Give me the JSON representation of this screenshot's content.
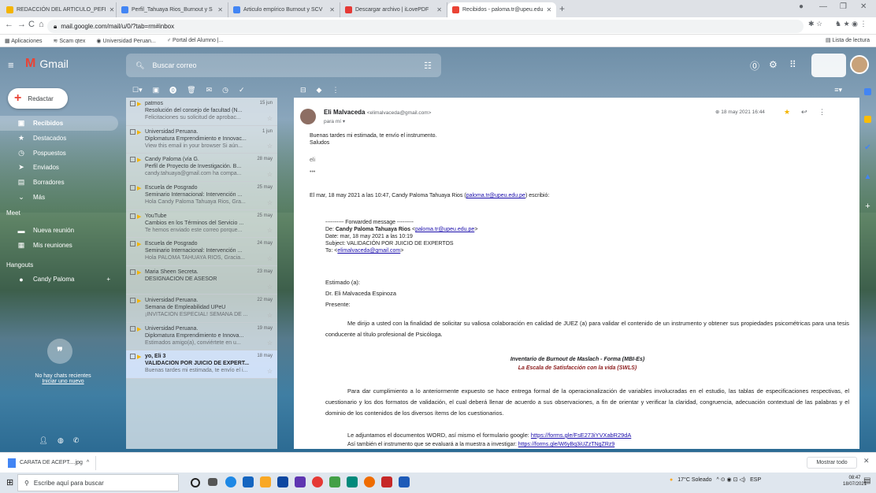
{
  "browser": {
    "tabs": [
      {
        "title": "REDACCIÓN DEL ARTICULO_PEFI",
        "color": "#f4b400"
      },
      {
        "title": "Perfil_Tahuaya Rios_Burnout y S",
        "color": "#4285f4"
      },
      {
        "title": "Articulo empírico Burnout y SCV",
        "color": "#4285f4"
      },
      {
        "title": "Descargar archivo | iLovePDF",
        "color": "#e53935"
      },
      {
        "title": "Recibidos - paloma.tr@upeu.edu",
        "color": "#ea4335"
      }
    ],
    "url": "mail.google.com/mail/u/0/?tab=rm#inbox",
    "bookmarks": [
      "Aplicaciones",
      "Scam qtex",
      "Universidad Peruan...",
      "Portal del Alumno |..."
    ],
    "reading_list": "Lista de lectura"
  },
  "gmail": {
    "logo_text": "Gmail",
    "search_placeholder": "Buscar correo",
    "compose_label": "Redactar",
    "nav": [
      {
        "label": "Recibidos",
        "icon": "inbox-icon",
        "glyph": "▣"
      },
      {
        "label": "Destacados",
        "icon": "star-icon",
        "glyph": "★"
      },
      {
        "label": "Pospuestos",
        "icon": "clock-icon",
        "glyph": "◷"
      },
      {
        "label": "Enviados",
        "icon": "send-icon",
        "glyph": "➤"
      },
      {
        "label": "Borradores",
        "icon": "draft-icon",
        "glyph": "▤"
      },
      {
        "label": "Más",
        "icon": "chevron-down-icon",
        "glyph": "⌄"
      }
    ],
    "meet": {
      "title": "Meet",
      "items": [
        "Nueva reunión",
        "Mis reuniones"
      ]
    },
    "hangouts": {
      "title": "Hangouts",
      "user": "Candy Paloma",
      "no_chats": "No hay chats recientes",
      "start_new": "Iniciar uno nuevo"
    }
  },
  "mails": [
    {
      "from": "patmos",
      "date": "15 jun",
      "subject": "Resolución del consejo de facultad (N...",
      "snippet": "Felicitaciones su solicitud de aprobac...",
      "unread": false
    },
    {
      "from": "Universidad Peruana.",
      "date": "1 jun",
      "subject": "Diplomatura Emprendimiento e Innovac...",
      "snippet": "View this email in your browser Si aún...",
      "unread": false
    },
    {
      "from": "Candy Paloma (vía G.",
      "date": "28 may",
      "subject": "Perfil de Proyecto de Investigación. B...",
      "snippet": "candy.tahuaya@gmail.com ha compa...",
      "unread": false
    },
    {
      "from": "Escuela de Posgrado",
      "date": "25 may",
      "subject": "Seminario Internacional: Intervención ...",
      "snippet": "Hola Candy Paloma Tahuaya Rios, Gra...",
      "unread": false
    },
    {
      "from": "YouTube",
      "date": "25 may",
      "subject": "Cambios en los Términos del Servicio ...",
      "snippet": "Te hemos enviado este correo porque...",
      "unread": false
    },
    {
      "from": "Escuela de Posgrado",
      "date": "24 may",
      "subject": "Seminario Internacional: Intervención ...",
      "snippet": "Hola PALOMA TAHUAYA RIOS, Gracia...",
      "unread": false
    },
    {
      "from": "Maria Sheen Secreta.",
      "date": "23 may",
      "subject": "DESIGNACIÓN DE ASESOR",
      "snippet": "",
      "unread": false
    },
    {
      "from": "Universidad Peruana.",
      "date": "22 may",
      "subject": "Semana de Empleabilidad UPeU",
      "snippet": "¡INVITACIÓN ESPECIAL! SEMANA DE ...",
      "unread": false
    },
    {
      "from": "Universidad Peruana.",
      "date": "19 may",
      "subject": "Diplomatura Emprendimiento e Innova...",
      "snippet": "Estimados amigo(a), conviértete en u...",
      "unread": false
    },
    {
      "from": "yo, Eli 3",
      "date": "18 may",
      "subject": "VALIDACIÓN POR JUICIO DE EXPERT...",
      "snippet": "Buenas tardes mi estimada, te envío el i...",
      "unread": true
    }
  ],
  "reader": {
    "sender_name": "Eli Malvaceda",
    "sender_email": "<elimalvaceda@gmail.com>",
    "to": "para mí ▾",
    "date": "18 may 2021 16:44",
    "reply_text": "Buenas tardes mi estimada, te envío el instrumento.",
    "greeting": "Saludos",
    "sign": "eli",
    "ellipsis": "•••",
    "quote_header_pre": "El mar, 18 may 2021 a las 10:47, Candy Paloma Tahuaya Rios (",
    "quote_header_link": "paloma.tr@upeu.edu.pe",
    "quote_header_post": ") escribió:",
    "fwd_title": "---------- Forwarded message ---------",
    "fwd_from_label": "De:",
    "fwd_from_name": "Candy Paloma Tahuaya Rios",
    "fwd_from_email": "paloma.tr@upeu.edu.pe",
    "fwd_date": "Date: mar, 18 may 2021 a las 10:19",
    "fwd_subject": "Subject: VALIDACIÓN POR JUICIO DE EXPERTOS",
    "fwd_to_label": "To:",
    "fwd_to_email": "elimalvaceda@gmail.com",
    "salutation": "Estimado (a):",
    "dr": "Dr. Eli Malvaceda Espinoza",
    "presente": "Presente:",
    "para1": "Me dirijo a usted con la finalidad de solicitar su valiosa colaboración en calidad de JUEZ (a) para validar el contenido de un instrumento y obtener sus propiedades psicométricas para una tesis conducente al título profesional de Psicóloga.",
    "inv1": "Inventario de Burnout de Maslach - Forma (MBI-Es)",
    "inv2": "La Escala de Satisfacción con la vida (SWLS)",
    "para2": "Para dar cumplimiento a lo anteriormente expuesto se hace entrega formal de la operacionalización de variables involucradas en el estudio, las tablas de especificaciones respectivas, el cuestionario y los dos formatos de validación, el cual deberá llenar de acuerdo a sus observaciones, a fin de orientar y verificar la claridad, congruencia, adecuación contextual de las palabras y el dominio de los contenidos de los diversos ítems de los cuestionarios.",
    "adj1": "Le adjuntamos el documentos WORD, así mismo el formulario google:",
    "adj1_link": "https://forms.gle/FsE273iYVXabR29dA",
    "adj2": "Así también el instrumento que se evaluará a la muestra a investigar:",
    "adj2_link": "https://forms.gle/W6yBq3iUZzTNgZRz9"
  },
  "downloads": {
    "file": "CARATA DE ACEPT....jpg",
    "show_all": "Mostrar todo"
  },
  "taskbar": {
    "search": "Escribe aquí para buscar",
    "weather": "17°C Soleado",
    "lang": "ESP",
    "time": "08:47",
    "date": "18/07/2021"
  }
}
